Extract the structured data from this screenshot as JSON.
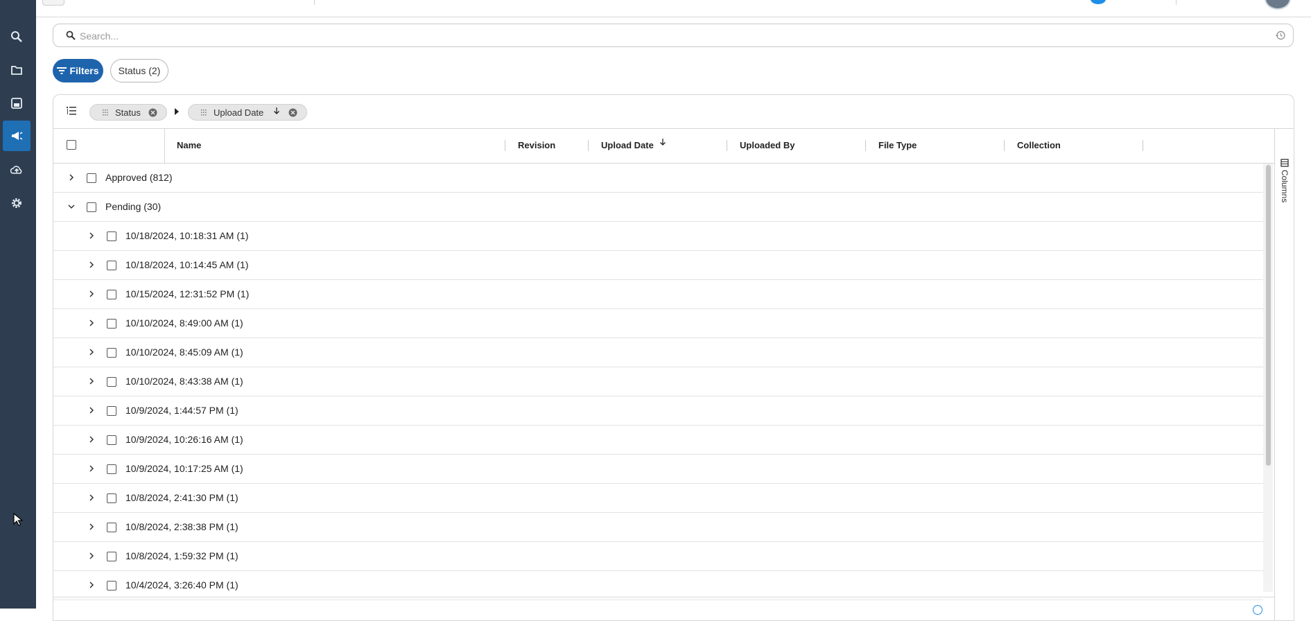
{
  "colors": {
    "rail_bg": "#2e3e50",
    "accent": "#1e64ad",
    "active_rail": "#1f6fb5"
  },
  "rail": {
    "items": [
      {
        "icon": "search-icon",
        "active": false
      },
      {
        "icon": "folder-icon",
        "active": false
      },
      {
        "icon": "save-icon",
        "active": false
      },
      {
        "icon": "megaphone-icon",
        "active": true
      },
      {
        "icon": "cloud-upload-icon",
        "active": false
      },
      {
        "icon": "gear-icon",
        "active": false
      }
    ]
  },
  "search": {
    "placeholder": "Search...",
    "value": ""
  },
  "filters": {
    "filters_label": "Filters",
    "status_label": "Status (2)"
  },
  "grouping": {
    "pills": [
      {
        "label": "Status"
      },
      {
        "label": "Upload Date"
      }
    ]
  },
  "columns": {
    "headers": [
      "Name",
      "Revision",
      "Upload Date",
      "Uploaded By",
      "File Type",
      "Collection"
    ],
    "side_panel_label": "Columns"
  },
  "rows": [
    {
      "label": "Approved (812)",
      "level": 0,
      "expanded": false
    },
    {
      "label": "Pending (30)",
      "level": 0,
      "expanded": true
    },
    {
      "label": "10/18/2024, 10:18:31 AM (1)",
      "level": 1,
      "expanded": false
    },
    {
      "label": "10/18/2024, 10:14:45 AM (1)",
      "level": 1,
      "expanded": false
    },
    {
      "label": "10/15/2024, 12:31:52 PM (1)",
      "level": 1,
      "expanded": false
    },
    {
      "label": "10/10/2024, 8:49:00 AM (1)",
      "level": 1,
      "expanded": false
    },
    {
      "label": "10/10/2024, 8:45:09 AM (1)",
      "level": 1,
      "expanded": false
    },
    {
      "label": "10/10/2024, 8:43:38 AM (1)",
      "level": 1,
      "expanded": false
    },
    {
      "label": "10/9/2024, 1:44:57 PM (1)",
      "level": 1,
      "expanded": false
    },
    {
      "label": "10/9/2024, 10:26:16 AM (1)",
      "level": 1,
      "expanded": false
    },
    {
      "label": "10/9/2024, 10:17:25 AM (1)",
      "level": 1,
      "expanded": false
    },
    {
      "label": "10/8/2024, 2:41:30 PM (1)",
      "level": 1,
      "expanded": false
    },
    {
      "label": "10/8/2024, 2:38:38 PM (1)",
      "level": 1,
      "expanded": false
    },
    {
      "label": "10/8/2024, 1:59:32 PM (1)",
      "level": 1,
      "expanded": false
    },
    {
      "label": "10/4/2024, 3:26:40 PM (1)",
      "level": 1,
      "expanded": false
    }
  ]
}
